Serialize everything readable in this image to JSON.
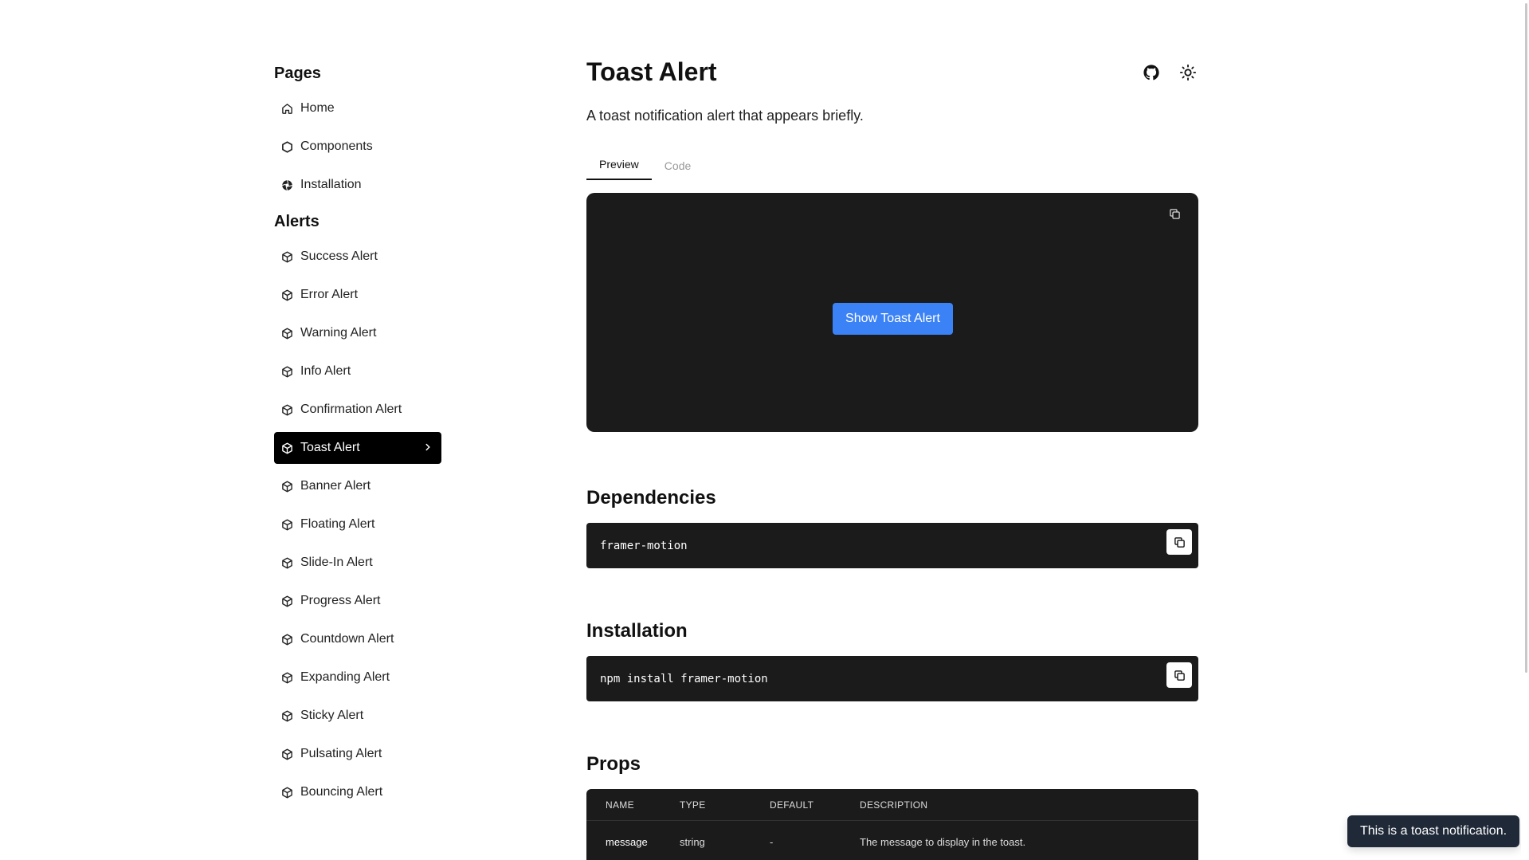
{
  "sidebar": {
    "pages_title": "Pages",
    "pages": [
      {
        "label": "Home",
        "icon": "home-icon"
      },
      {
        "label": "Components",
        "icon": "hexagon-icon"
      },
      {
        "label": "Installation",
        "icon": "aperture-icon"
      }
    ],
    "alerts_title": "Alerts",
    "alerts": [
      {
        "label": "Success Alert"
      },
      {
        "label": "Error Alert"
      },
      {
        "label": "Warning Alert"
      },
      {
        "label": "Info Alert"
      },
      {
        "label": "Confirmation Alert"
      },
      {
        "label": "Toast Alert",
        "active": true
      },
      {
        "label": "Banner Alert"
      },
      {
        "label": "Floating Alert"
      },
      {
        "label": "Slide-In Alert"
      },
      {
        "label": "Progress Alert"
      },
      {
        "label": "Countdown Alert"
      },
      {
        "label": "Expanding Alert"
      },
      {
        "label": "Sticky Alert"
      },
      {
        "label": "Pulsating Alert"
      },
      {
        "label": "Bouncing Alert"
      }
    ],
    "alert_icon": "package-icon"
  },
  "main": {
    "title": "Toast Alert",
    "description": "A toast notification alert that appears briefly.",
    "tabs": [
      {
        "label": "Preview",
        "active": true
      },
      {
        "label": "Code",
        "active": false
      }
    ],
    "preview_button": "Show Toast Alert",
    "dependencies_title": "Dependencies",
    "dependencies_code": "framer-motion",
    "installation_title": "Installation",
    "installation_code": "npm install framer-motion",
    "props_title": "Props",
    "props_headers": [
      "NAME",
      "TYPE",
      "DEFAULT",
      "DESCRIPTION"
    ],
    "props_rows": [
      [
        "message",
        "string",
        "-",
        "The message to display in the toast."
      ]
    ]
  },
  "toast": {
    "text": "This is a toast notification."
  },
  "colors": {
    "accent": "#3b82f6",
    "dark": "#1b1b1b",
    "toast_bg": "#1f2937"
  }
}
